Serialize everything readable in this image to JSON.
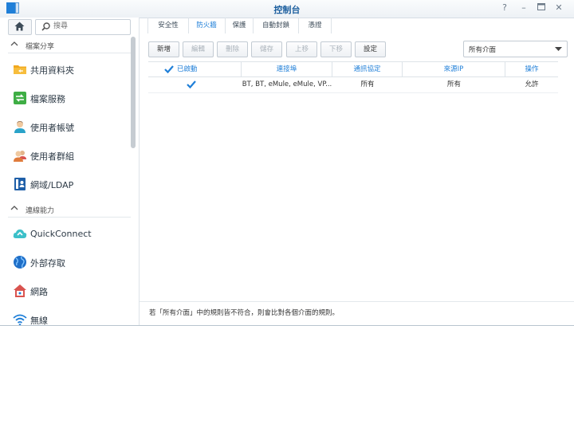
{
  "window": {
    "title": "控制台",
    "buttons": {
      "help": "?",
      "minimize": "–",
      "maximize": "□",
      "close": "✕"
    }
  },
  "sidebar": {
    "search_placeholder": "搜尋",
    "sections": [
      {
        "label": "檔案分享",
        "items": [
          {
            "label": "共用資料夾",
            "icon": "shared-folder-icon"
          },
          {
            "label": "檔案服務",
            "icon": "file-services-icon"
          },
          {
            "label": "使用者帳號",
            "icon": "user-icon"
          },
          {
            "label": "使用者群組",
            "icon": "group-icon"
          },
          {
            "label": "網域/LDAP",
            "icon": "ldap-icon"
          }
        ]
      },
      {
        "label": "連線能力",
        "items": [
          {
            "label": "QuickConnect",
            "icon": "quickconnect-icon"
          },
          {
            "label": "外部存取",
            "icon": "globe-icon"
          },
          {
            "label": "網路",
            "icon": "network-house-icon"
          },
          {
            "label": "無線",
            "icon": "wifi-icon"
          }
        ]
      }
    ]
  },
  "tabs": [
    {
      "label": "安全性",
      "active": false
    },
    {
      "label": "防火牆",
      "active": true
    },
    {
      "label": "保護",
      "active": false
    },
    {
      "label": "自動封鎖",
      "active": false
    },
    {
      "label": "憑證",
      "active": false
    }
  ],
  "toolbar": {
    "create": "新增",
    "edit": "編輯",
    "delete": "刪除",
    "save": "儲存",
    "move_up": "上移",
    "move_down": "下移",
    "settings": "設定",
    "interface_select": "所有介面"
  },
  "grid": {
    "columns": {
      "enabled": "已啟動",
      "ports": "連接埠",
      "protocol": "通訊協定",
      "source_ip": "來源IP",
      "action": "操作"
    },
    "rows": [
      {
        "enabled": true,
        "ports": "BT, BT, eMule, eMule, VP...",
        "protocol": "所有",
        "source_ip": "所有",
        "action": "允許"
      }
    ]
  },
  "footer_note": "若「所有介面」中的規則皆不符合，則會比對各個介面的規則。",
  "colors": {
    "accent": "#1f7fd8",
    "title": "#1b5e9e"
  }
}
